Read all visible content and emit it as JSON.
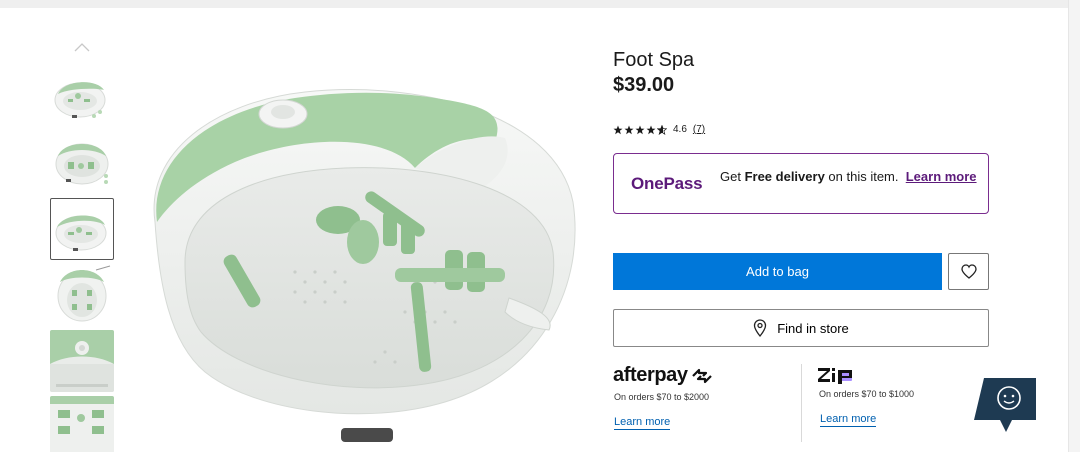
{
  "product": {
    "title": "Foot Spa",
    "price": "$39.00",
    "rating_value": "4.6",
    "rating_stars": 4.6,
    "rating_count": "(7)"
  },
  "onepass": {
    "logo_text": "OnePass",
    "text_pre": "Get ",
    "text_bold": "Free delivery",
    "text_post": " on this item.",
    "link_label": "Learn more",
    "accent_color": "#5c1a7a"
  },
  "actions": {
    "add_to_bag": "Add to bag",
    "find_in_store": "Find in store",
    "wishlist_icon": "heart-icon",
    "primary_color": "#0077d9"
  },
  "payments": {
    "afterpay": {
      "logo_text": "afterpay",
      "note": "On orders $70 to $2000",
      "link_label": "Learn more"
    },
    "zip": {
      "logo_text": "zip",
      "note": "On orders $70 to $1000",
      "link_label": "Learn more"
    }
  },
  "gallery": {
    "thumbnail_count": 6,
    "active_index": 2,
    "up_icon": "chevron-up-icon"
  },
  "chat": {
    "icon": "smiley-chat-icon",
    "color": "#1e3a52"
  }
}
